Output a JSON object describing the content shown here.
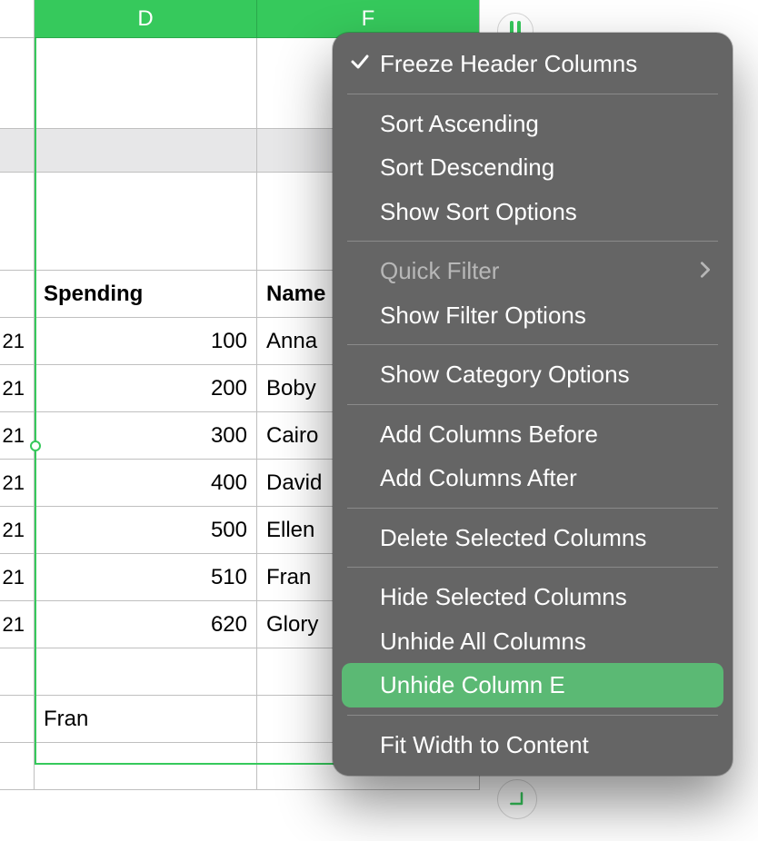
{
  "columns": {
    "d_label": "D",
    "f_label": "F"
  },
  "headers": {
    "d": "Spending",
    "f": "Name"
  },
  "rows": [
    {
      "stub": "21",
      "d": "100",
      "f": "Anna"
    },
    {
      "stub": "21",
      "d": "200",
      "f": "Boby"
    },
    {
      "stub": "21",
      "d": "300",
      "f": "Cairo"
    },
    {
      "stub": "21",
      "d": "400",
      "f": "David"
    },
    {
      "stub": "21",
      "d": "500",
      "f": "Ellen"
    },
    {
      "stub": "21",
      "d": "510",
      "f": "Fran"
    },
    {
      "stub": "21",
      "d": "620",
      "f": "Glory"
    }
  ],
  "extra_rows": [
    {
      "stub": "",
      "d": "",
      "f": ""
    },
    {
      "stub": "",
      "d": "Fran",
      "f": ""
    },
    {
      "stub": "",
      "d": "",
      "f": ""
    }
  ],
  "menu": {
    "freeze_header": "Freeze Header Columns",
    "sort_asc": "Sort Ascending",
    "sort_desc": "Sort Descending",
    "show_sort_opts": "Show Sort Options",
    "quick_filter": "Quick Filter",
    "show_filter_opts": "Show Filter Options",
    "show_category_opts": "Show Category Options",
    "add_cols_before": "Add Columns Before",
    "add_cols_after": "Add Columns After",
    "delete_selected": "Delete Selected Columns",
    "hide_selected": "Hide Selected Columns",
    "unhide_all": "Unhide All Columns",
    "unhide_e": "Unhide Column E",
    "fit_width": "Fit Width to Content"
  }
}
